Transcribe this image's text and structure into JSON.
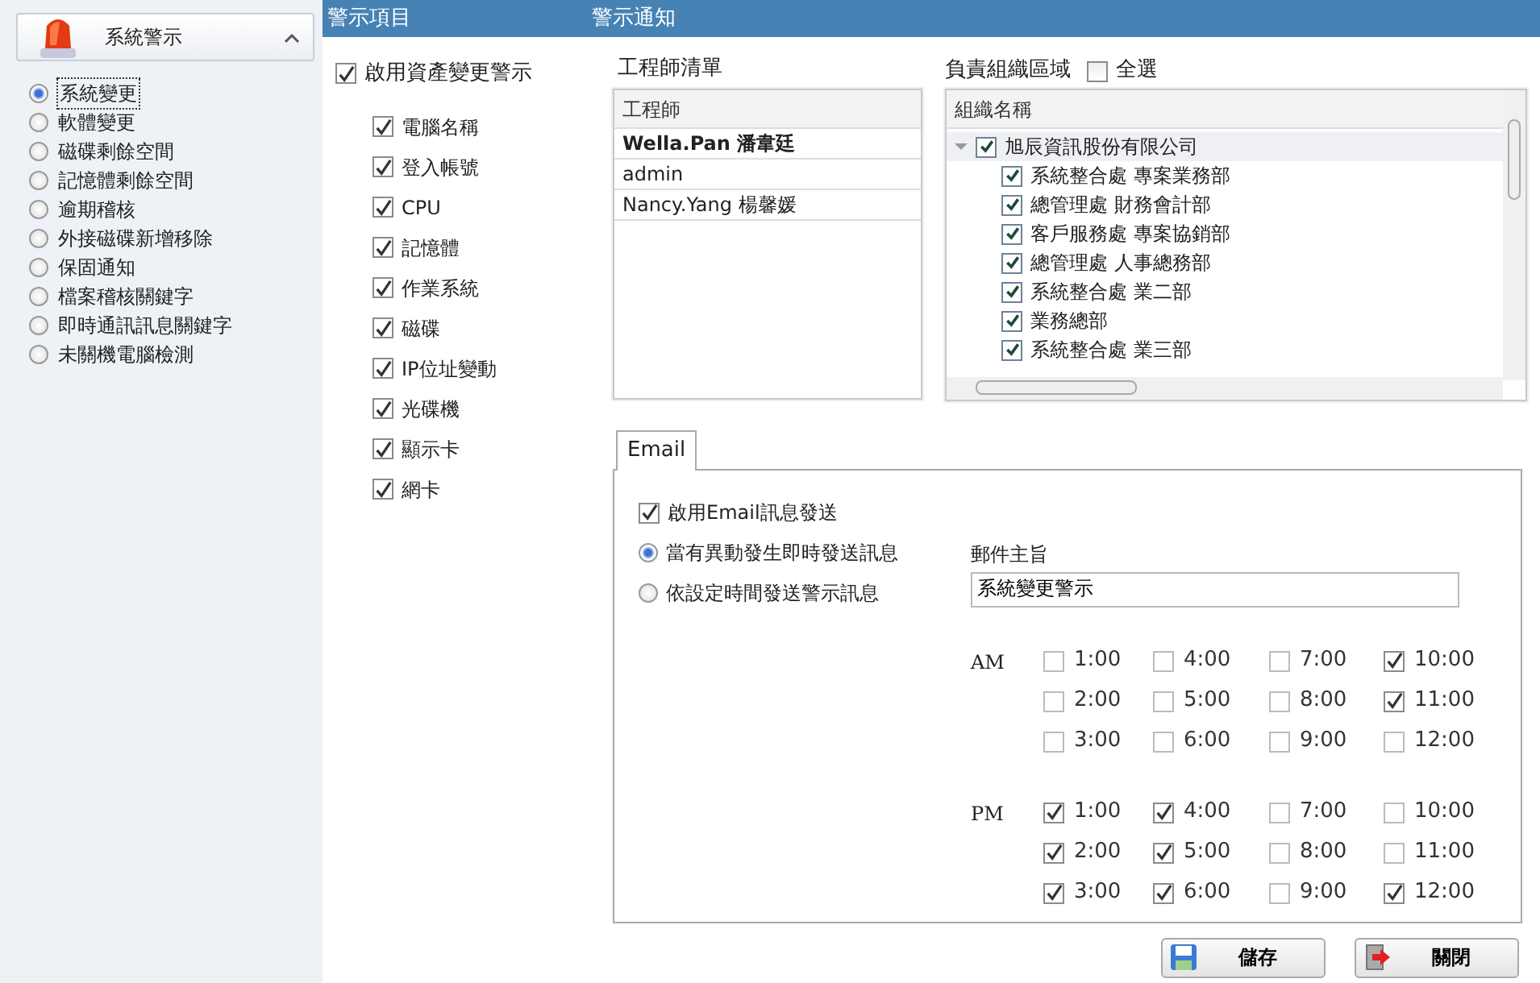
{
  "sidebar": {
    "title": "系統警示",
    "expanded": true,
    "items": [
      {
        "label": "系統變更",
        "selected": true
      },
      {
        "label": "軟體變更",
        "selected": false
      },
      {
        "label": "磁碟剩餘空間",
        "selected": false
      },
      {
        "label": "記憶體剩餘空間",
        "selected": false
      },
      {
        "label": "逾期稽核",
        "selected": false
      },
      {
        "label": "外接磁碟新增移除",
        "selected": false
      },
      {
        "label": "保固通知",
        "selected": false
      },
      {
        "label": "檔案稽核關鍵字",
        "selected": false
      },
      {
        "label": "即時通訊訊息關鍵字",
        "selected": false
      },
      {
        "label": "未關機電腦檢測",
        "selected": false
      }
    ]
  },
  "alert_items": {
    "heading": "警示項目",
    "enable": {
      "label": "啟用資產變更警示",
      "checked": true
    },
    "items": [
      {
        "label": "電腦名稱",
        "checked": true
      },
      {
        "label": "登入帳號",
        "checked": true
      },
      {
        "label": "CPU",
        "checked": true
      },
      {
        "label": "記憶體",
        "checked": true
      },
      {
        "label": "作業系統",
        "checked": true
      },
      {
        "label": "磁碟",
        "checked": true
      },
      {
        "label": "IP位址變動",
        "checked": true
      },
      {
        "label": "光碟機",
        "checked": true
      },
      {
        "label": "顯示卡",
        "checked": true
      },
      {
        "label": "網卡",
        "checked": true
      }
    ]
  },
  "notification": {
    "heading": "警示通知",
    "engineers": {
      "title": "工程師清單",
      "column": "工程師",
      "rows": [
        {
          "name": "Wella.Pan 潘韋廷",
          "selected": true
        },
        {
          "name": "admin",
          "selected": false
        },
        {
          "name": "Nancy.Yang 楊馨媛",
          "selected": false
        }
      ]
    },
    "org": {
      "title": "負責組織區域",
      "select_all": {
        "label": "全選",
        "checked": false
      },
      "column": "組織名稱",
      "tree": [
        {
          "label": "旭辰資訊股份有限公司",
          "checked": true,
          "expanded": true,
          "children": [
            {
              "label": "系統整合處 專案業務部",
              "checked": true
            },
            {
              "label": "總管理處 財務會計部",
              "checked": true
            },
            {
              "label": "客戶服務處 專案協銷部",
              "checked": true
            },
            {
              "label": "總管理處 人事總務部",
              "checked": true
            },
            {
              "label": "系統整合處 業二部",
              "checked": true
            },
            {
              "label": "業務總部",
              "checked": true
            },
            {
              "label": "系統整合處 業三部",
              "checked": true
            }
          ]
        }
      ]
    },
    "tabs": [
      {
        "label": "Email",
        "selected": true
      }
    ],
    "email": {
      "enable": {
        "label": "啟用Email訊息發送",
        "checked": true
      },
      "modes": [
        {
          "label": "當有異動發生即時發送訊息",
          "selected": true
        },
        {
          "label": "依設定時間發送警示訊息",
          "selected": false
        }
      ],
      "subject_label": "郵件主旨",
      "subject": "系統變更警示",
      "schedule": [
        {
          "period": "AM",
          "slots": [
            {
              "label": "1:00",
              "checked": false
            },
            {
              "label": "2:00",
              "checked": false
            },
            {
              "label": "3:00",
              "checked": false
            },
            {
              "label": "4:00",
              "checked": false
            },
            {
              "label": "5:00",
              "checked": false
            },
            {
              "label": "6:00",
              "checked": false
            },
            {
              "label": "7:00",
              "checked": false
            },
            {
              "label": "8:00",
              "checked": false
            },
            {
              "label": "9:00",
              "checked": false
            },
            {
              "label": "10:00",
              "checked": true
            },
            {
              "label": "11:00",
              "checked": true
            },
            {
              "label": "12:00",
              "checked": false
            }
          ]
        },
        {
          "period": "PM",
          "slots": [
            {
              "label": "1:00",
              "checked": true
            },
            {
              "label": "2:00",
              "checked": true
            },
            {
              "label": "3:00",
              "checked": true
            },
            {
              "label": "4:00",
              "checked": true
            },
            {
              "label": "5:00",
              "checked": true
            },
            {
              "label": "6:00",
              "checked": true
            },
            {
              "label": "7:00",
              "checked": false
            },
            {
              "label": "8:00",
              "checked": false
            },
            {
              "label": "9:00",
              "checked": false
            },
            {
              "label": "10:00",
              "checked": false
            },
            {
              "label": "11:00",
              "checked": false
            },
            {
              "label": "12:00",
              "checked": true
            }
          ]
        }
      ]
    }
  },
  "buttons": [
    {
      "kind": "save",
      "label": "儲存"
    },
    {
      "kind": "close",
      "label": "關閉"
    }
  ]
}
